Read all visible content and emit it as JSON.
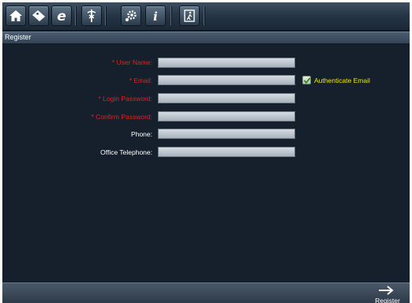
{
  "toolbar": {
    "buttons": [
      {
        "icon": "home-icon"
      },
      {
        "icon": "tag-icon"
      },
      {
        "icon": "browser-e-icon"
      },
      {
        "icon": "caduceus-icon"
      },
      {
        "icon": "settings-gear-icon"
      },
      {
        "icon": "info-icon"
      },
      {
        "icon": "exit-door-icon"
      }
    ]
  },
  "section": {
    "title": "Register"
  },
  "form": {
    "user_name_label": "* User Name:",
    "email_label": "* Email:",
    "login_password_label": "* Login Password:",
    "confirm_password_label": "* Confirm Password:",
    "phone_label": "Phone:",
    "office_telephone_label": "Office Telephone:",
    "user_name_value": "",
    "email_value": "",
    "login_password_value": "",
    "confirm_password_value": "",
    "phone_value": "",
    "office_telephone_value": "",
    "authenticate_email": {
      "label": "Authenticate Email",
      "checked": true
    }
  },
  "footer": {
    "register_label": "Register"
  },
  "colors": {
    "required": "#e02020",
    "checkbox_label": "#f2e200",
    "background": "#16202c"
  }
}
